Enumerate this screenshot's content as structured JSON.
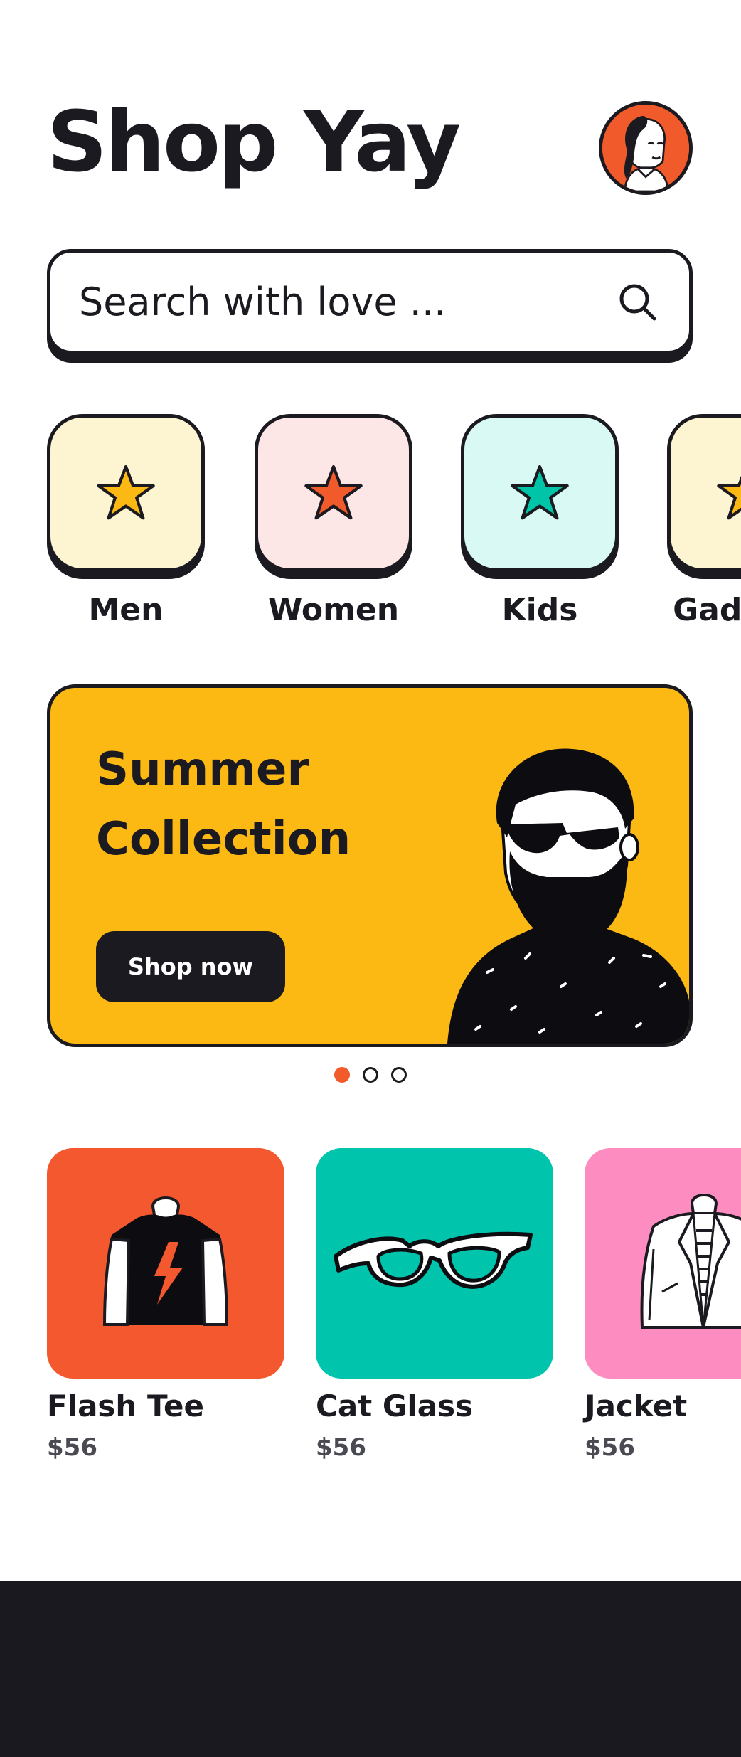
{
  "app": {
    "title": "Shop Yay"
  },
  "profile": {
    "avatar_icon": "user-avatar"
  },
  "search": {
    "placeholder": "Search with love ...",
    "icon": "search-icon"
  },
  "categories": [
    {
      "label": "Men",
      "color": "#fdf5d2",
      "star_color": "#fcb813"
    },
    {
      "label": "Women",
      "color": "#fde6e6",
      "star_color": "#f15a2b"
    },
    {
      "label": "Kids",
      "color": "#d9faf4",
      "star_color": "#00c4a7"
    },
    {
      "label": "Gadgets",
      "color": "#fdf5d2",
      "star_color": "#fcb813"
    }
  ],
  "banner": {
    "headline_line1": "Summer",
    "headline_line2": "Collection",
    "cta_label": "Shop now",
    "background": "#fcb813"
  },
  "carousel": {
    "count": 3,
    "active": 0,
    "active_color": "#f15a2b"
  },
  "products": [
    {
      "name": "Flash Tee",
      "price": "$56",
      "color": "#f4582f",
      "icon": "t-shirt-icon"
    },
    {
      "name": "Cat Glass",
      "price": "$56",
      "color": "#00c4ac",
      "icon": "glasses-icon"
    },
    {
      "name": "Jacket",
      "price": "$56",
      "color": "#fd8dc0",
      "icon": "jacket-icon"
    }
  ],
  "colors": {
    "ink": "#1b1a20",
    "bottom_bar": "#1a1920"
  }
}
